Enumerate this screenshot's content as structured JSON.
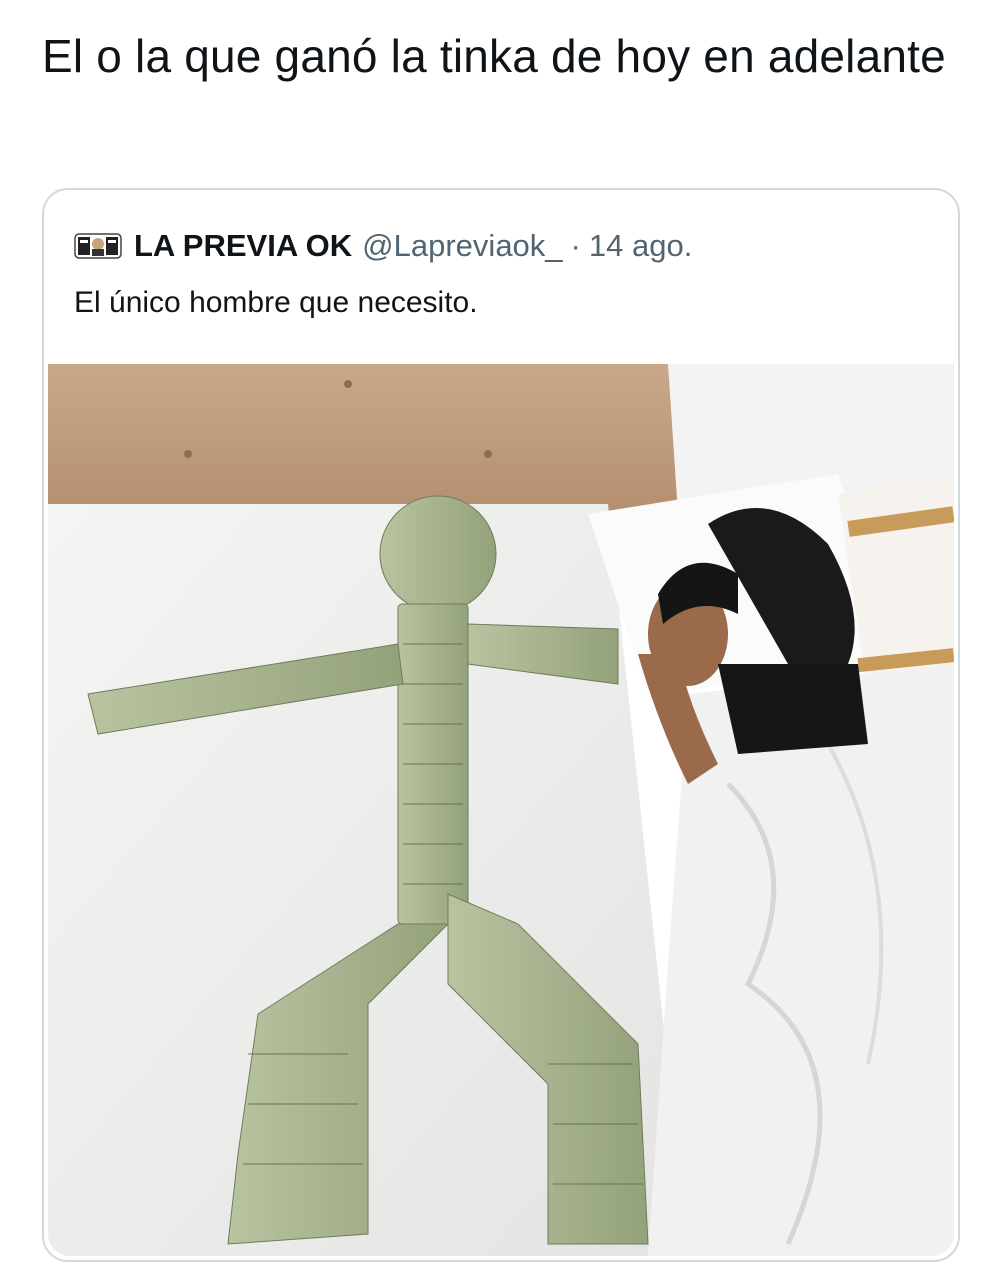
{
  "tweet": {
    "text": "El o la que ganó la tinka de hoy en adelante"
  },
  "quoted_tweet": {
    "display_name": "LA PREVIA OK",
    "handle": "@Lapreviaok_",
    "separator": "·",
    "date": "14 ago.",
    "text": "El único hombre que necesito.",
    "avatar_icon": "logo-avatar-icon",
    "media_description_icon": "photo-media"
  },
  "colors": {
    "text_primary": "#0f1419",
    "text_secondary": "#536471",
    "card_border": "#cfd9de"
  }
}
